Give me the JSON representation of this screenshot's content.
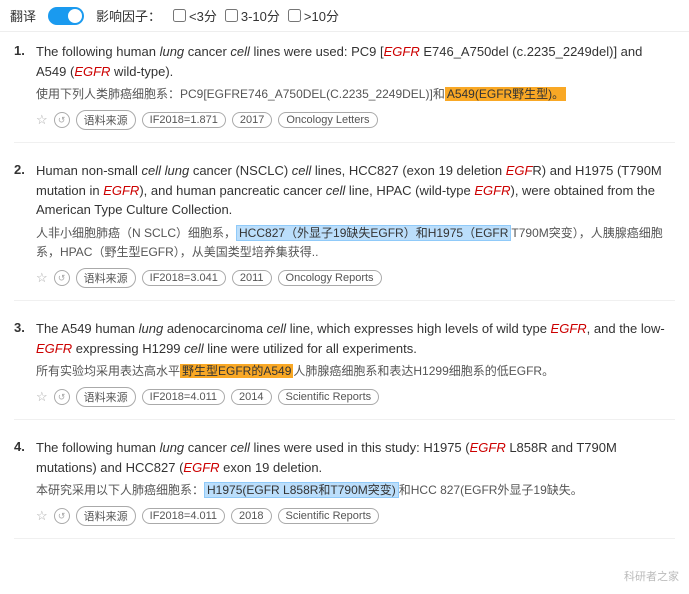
{
  "topbar": {
    "translate_label": "翻译",
    "impact_label": "影响因子：",
    "filter1": "<3分",
    "filter2": "3-10分",
    "filter3": ">10分"
  },
  "results": [
    {
      "num": "1.",
      "en_parts": [
        {
          "text": "The following human ",
          "type": "normal"
        },
        {
          "text": "lung",
          "type": "italic"
        },
        {
          "text": " cancer ",
          "type": "normal"
        },
        {
          "text": "cell",
          "type": "italic"
        },
        {
          "text": " lines were used: PC9 [",
          "type": "normal"
        },
        {
          "text": "EGFR",
          "type": "red-italic"
        },
        {
          "text": " E746_A750del (c.2235_2249del)] and A549 (",
          "type": "normal"
        },
        {
          "text": "EGFR",
          "type": "red-italic"
        },
        {
          "text": " wild-type).",
          "type": "normal"
        }
      ],
      "zh_parts": [
        {
          "text": "使用下列人类肺癌细胞系：PC9[EGFRE746_A750DEL(C.2235_2249DEL)]和",
          "type": "normal"
        },
        {
          "text": "A549(EGFR野生型)。",
          "type": "highlight-box"
        }
      ],
      "meta": {
        "source": "语料来源",
        "if": "IF2018=1.871",
        "year": "2017",
        "journal": "Oncology Letters"
      }
    },
    {
      "num": "2.",
      "en_parts": [
        {
          "text": "Human non-small ",
          "type": "normal"
        },
        {
          "text": "cell lung",
          "type": "italic"
        },
        {
          "text": " cancer (NSCLC) ",
          "type": "normal"
        },
        {
          "text": "cell",
          "type": "italic"
        },
        {
          "text": " lines, HCC827 (exon 19 deletion ",
          "type": "normal"
        },
        {
          "text": "EGF",
          "type": "red-italic"
        },
        {
          "text": "R) and H1975 (T790M mutation in ",
          "type": "normal"
        },
        {
          "text": "EGFR",
          "type": "red-italic"
        },
        {
          "text": "), and human pancreatic cancer ",
          "type": "normal"
        },
        {
          "text": "cell",
          "type": "italic"
        },
        {
          "text": " line, HPAC (wild-type ",
          "type": "normal"
        },
        {
          "text": "EGFR",
          "type": "red-italic"
        },
        {
          "text": "), were obtained from the American Type Culture Collection.",
          "type": "normal"
        }
      ],
      "zh_parts": [
        {
          "text": "人非小细胞肺癌（N SCLC）细胞系，",
          "type": "normal"
        },
        {
          "text": "HCC827（外显子19缺失EGFR）和H1975（EGFR",
          "type": "highlight-blue"
        },
        {
          "text": "T790M突变），人胰腺癌细胞系，HPAC（野生型EGFR），从美国类型培养集获得..",
          "type": "normal"
        }
      ],
      "meta": {
        "source": "语料来源",
        "if": "IF2018=3.041",
        "year": "2011",
        "journal": "Oncology Reports"
      }
    },
    {
      "num": "3.",
      "en_parts": [
        {
          "text": "The A549 human ",
          "type": "normal"
        },
        {
          "text": "lung",
          "type": "italic"
        },
        {
          "text": " adenocarcinoma ",
          "type": "normal"
        },
        {
          "text": "cell",
          "type": "italic"
        },
        {
          "text": " line, which expresses high levels of wild type ",
          "type": "normal"
        },
        {
          "text": "EGFR",
          "type": "red-italic"
        },
        {
          "text": ", and the low-",
          "type": "normal"
        },
        {
          "text": "EGFR",
          "type": "red-italic"
        },
        {
          "text": " expressing H1299 ",
          "type": "normal"
        },
        {
          "text": "cell",
          "type": "italic"
        },
        {
          "text": " line were utilized for all experiments.",
          "type": "normal"
        }
      ],
      "zh_parts": [
        {
          "text": "所有实验均采用表达高水平",
          "type": "normal"
        },
        {
          "text": "野生型EGFR的A549",
          "type": "highlight-box"
        },
        {
          "text": "人肺腺癌细胞系和表达H1299细胞系的低EGFR。",
          "type": "normal"
        }
      ],
      "meta": {
        "source": "语料来源",
        "if": "IF2018=4.011",
        "year": "2014",
        "journal": "Scientific Reports"
      }
    },
    {
      "num": "4.",
      "en_parts": [
        {
          "text": "The following human ",
          "type": "normal"
        },
        {
          "text": "lung",
          "type": "italic"
        },
        {
          "text": " cancer ",
          "type": "normal"
        },
        {
          "text": "cell",
          "type": "italic"
        },
        {
          "text": " lines were used in this study: H1975 (",
          "type": "normal"
        },
        {
          "text": "EGFR",
          "type": "red-italic"
        },
        {
          "text": " L858R and T790M mutations) and HCC827 (",
          "type": "normal"
        },
        {
          "text": "EGFR",
          "type": "red-italic"
        },
        {
          "text": " exon 19 deletion.",
          "type": "normal"
        }
      ],
      "zh_parts": [
        {
          "text": "本研究采用以下人肺癌细胞系：",
          "type": "normal"
        },
        {
          "text": "H1975(EGFR L858R和T790M突变)",
          "type": "highlight-blue"
        },
        {
          "text": "和HCC 827(EGFR外显子19缺失。",
          "type": "normal"
        }
      ],
      "meta": {
        "source": "语料来源",
        "if": "IF2018=4.011",
        "year": "2018",
        "journal": "Scientific Reports"
      }
    }
  ],
  "watermark": "科研者之家"
}
